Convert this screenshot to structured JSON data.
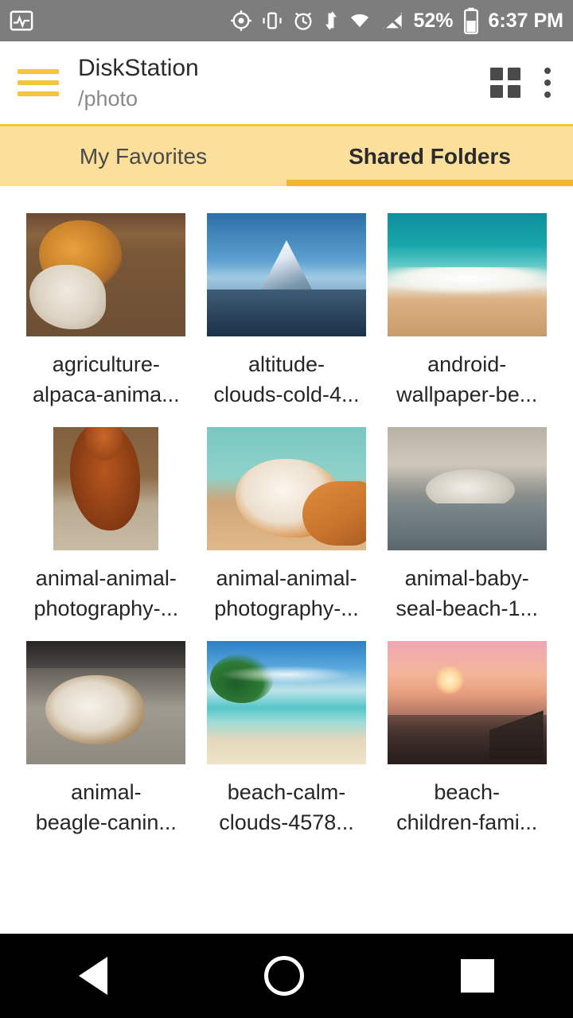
{
  "status_bar": {
    "icons_left": [
      "activity-icon"
    ],
    "icons_right": [
      "location-crosshair-icon",
      "vibrate-icon",
      "alarm-icon",
      "data-transfer-icon",
      "wifi-icon",
      "no-signal-icon"
    ],
    "battery_percent": "52%",
    "clock": "6:37 PM"
  },
  "app_bar": {
    "menu_icon": "hamburger-icon",
    "title": "DiskStation",
    "subtitle": "/photo",
    "view_toggle_icon": "grid-view-icon",
    "overflow_icon": "more-vertical-icon"
  },
  "tabs": [
    {
      "label": "My Favorites",
      "active": false
    },
    {
      "label": "Shared Folders",
      "active": true
    }
  ],
  "gallery": {
    "rows": [
      [
        {
          "caption": "agriculture-\nalpaca-anima...",
          "thumb_class": "t-alpaca",
          "orientation": "landscape"
        },
        {
          "caption": "altitude-\nclouds-cold-4...",
          "thumb_class": "t-mountain",
          "orientation": "landscape"
        },
        {
          "caption": "android-\nwallpaper-be...",
          "thumb_class": "t-beachwave",
          "orientation": "landscape"
        }
      ],
      [
        {
          "caption": "animal-animal-\nphotography-...",
          "thumb_class": "t-alpaca2",
          "orientation": "portrait"
        },
        {
          "caption": "animal-animal-\nphotography-...",
          "thumb_class": "t-cat",
          "orientation": "landscape"
        },
        {
          "caption": "animal-baby-\nseal-beach-1...",
          "thumb_class": "t-seal",
          "orientation": "landscape"
        }
      ],
      [
        {
          "caption": "animal-\nbeagle-canin...",
          "thumb_class": "t-beagle",
          "orientation": "landscape"
        },
        {
          "caption": "beach-calm-\nclouds-4578...",
          "thumb_class": "t-beachcalm",
          "orientation": "landscape"
        },
        {
          "caption": "beach-\nchildren-fami...",
          "thumb_class": "t-sunset",
          "orientation": "landscape"
        }
      ]
    ]
  },
  "nav_bar": {
    "back_icon": "back-triangle-icon",
    "home_icon": "home-circle-icon",
    "recents_icon": "recents-square-icon"
  },
  "colors": {
    "accent": "#f0b92c",
    "tab_bg": "#fbdf9b",
    "status_bg": "#7d7d7d"
  }
}
